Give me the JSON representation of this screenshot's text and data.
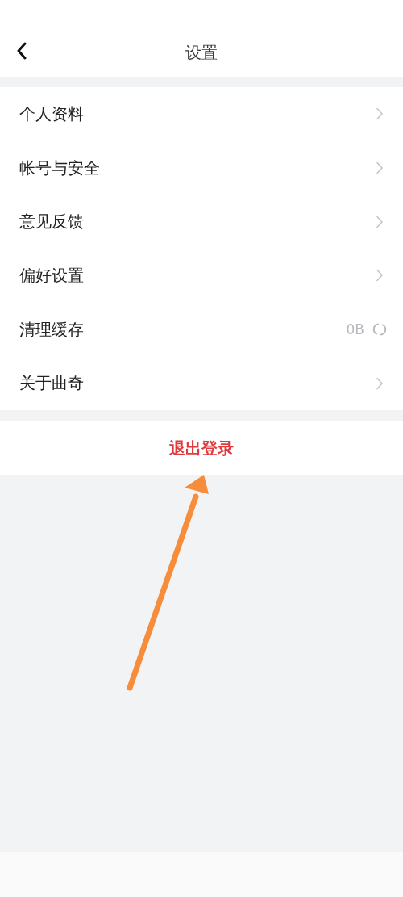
{
  "header": {
    "title": "设置"
  },
  "items": [
    {
      "kind": "link",
      "label": "个人资料"
    },
    {
      "kind": "link",
      "label": "帐号与安全"
    },
    {
      "kind": "link",
      "label": "意见反馈"
    },
    {
      "kind": "link",
      "label": "偏好设置"
    },
    {
      "kind": "cache",
      "label": "清理缓存",
      "value": "0B"
    },
    {
      "kind": "link",
      "label": "关于曲奇"
    }
  ],
  "logout": {
    "label": "退出登录"
  }
}
